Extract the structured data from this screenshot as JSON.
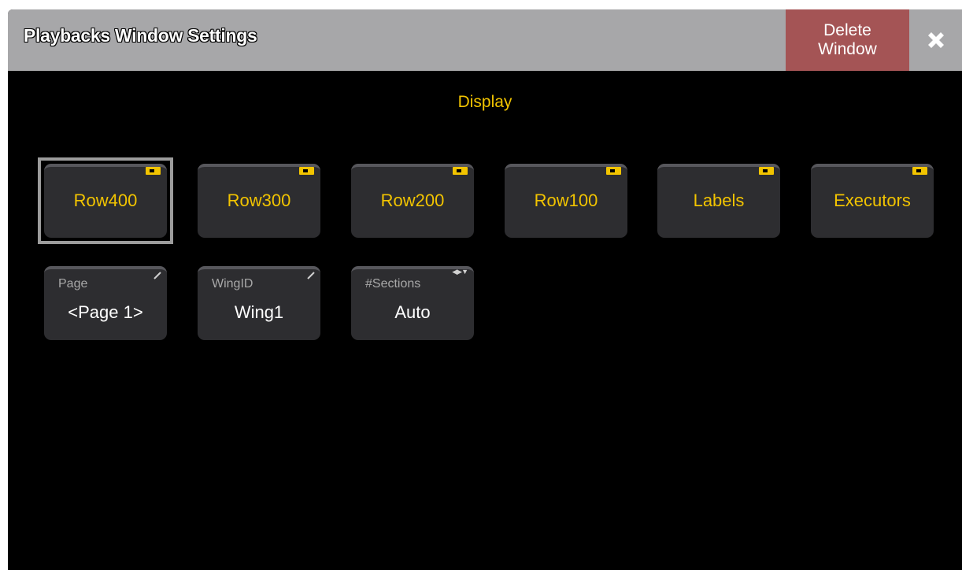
{
  "window": {
    "title": "Playbacks Window Settings",
    "delete_label_line1": "Delete",
    "delete_label_line2": "Window",
    "close_icon": "close-x-icon"
  },
  "section": {
    "title": "Display"
  },
  "toggles": [
    {
      "label": "Row400",
      "state": "on",
      "selected": true
    },
    {
      "label": "Row300",
      "state": "on",
      "selected": false
    },
    {
      "label": "Row200",
      "state": "on",
      "selected": false
    },
    {
      "label": "Row100",
      "state": "on",
      "selected": false
    },
    {
      "label": "Labels",
      "state": "on",
      "selected": false
    },
    {
      "label": "Executors",
      "state": "on",
      "selected": false
    }
  ],
  "properties": [
    {
      "name": "Page",
      "value": "<Page 1>",
      "indicator": "edit"
    },
    {
      "name": "WingID",
      "value": "Wing1",
      "indicator": "edit"
    },
    {
      "name": "#Sections",
      "value": "Auto",
      "indicator": "select-arrows"
    }
  ],
  "colors": {
    "accent_yellow": "#f2c400",
    "titlebar_gray": "#a7a7a9",
    "delete_red": "#a45455",
    "button_bg": "#2d2d30",
    "background": "#000000"
  }
}
